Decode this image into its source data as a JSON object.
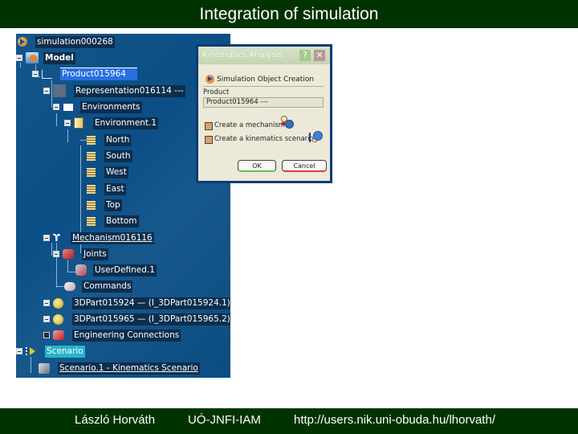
{
  "slide": {
    "title": "Integration of simulation"
  },
  "footer": {
    "author": "László Horváth",
    "institution": "UÓ-JNFI-IAM",
    "url": "http://users.nik.uni-obuda.hu/lhorvath/"
  },
  "tree": {
    "items": [
      {
        "label": "simulation000268",
        "icon": "simulation-icon",
        "depth": 0
      },
      {
        "label": "Model",
        "icon": "model-icon",
        "depth": 0
      },
      {
        "label": "Product015964",
        "icon": "product-icon",
        "depth": 1,
        "state": "selected"
      },
      {
        "label": "Representation016114 ---",
        "icon": "representation-icon",
        "depth": 2
      },
      {
        "label": "Environments",
        "icon": "environments-icon",
        "depth": 3
      },
      {
        "label": "Environment.1",
        "icon": "environment-icon",
        "depth": 4
      },
      {
        "label": "North",
        "icon": "wall-icon",
        "depth": 5
      },
      {
        "label": "South",
        "icon": "wall-icon",
        "depth": 5
      },
      {
        "label": "West",
        "icon": "wall-icon",
        "depth": 5
      },
      {
        "label": "East",
        "icon": "wall-icon",
        "depth": 5
      },
      {
        "label": "Top",
        "icon": "wall-icon",
        "depth": 5
      },
      {
        "label": "Bottom",
        "icon": "wall-icon",
        "depth": 5
      },
      {
        "label": "Mechanism016116",
        "icon": "mechanism-icon",
        "depth": 2
      },
      {
        "label": "Joints",
        "icon": "joints-icon",
        "depth": 3
      },
      {
        "label": "UserDefined.1",
        "icon": "joint-icon",
        "depth": 4
      },
      {
        "label": "Commands",
        "icon": "commands-icon",
        "depth": 3
      },
      {
        "label": "3DPart015924 — (I_3DPart015924.1)",
        "icon": "part-icon",
        "depth": 2
      },
      {
        "label": "3DPart015965 — (I_3DPart015965.2)",
        "icon": "part-icon",
        "depth": 2
      },
      {
        "label": "Engineering Connections",
        "icon": "connections-icon",
        "depth": 2
      },
      {
        "label": "Scenario",
        "icon": "scenario-icon",
        "depth": 0,
        "state": "highlighted"
      },
      {
        "label": "Scenario.1 - Kinematics Scenario",
        "icon": "kinematics-scenario-icon",
        "depth": 1
      }
    ]
  },
  "dialog": {
    "title": "Kinematics Analysis",
    "help_label": "?",
    "close_label": "✕",
    "section_label": "Simulation Object Creation",
    "product_label": "Product",
    "product_value": "Product015964 ---",
    "options": [
      {
        "label": "Create a mechanism",
        "checked": false
      },
      {
        "label": "Create a kinematics scenario",
        "checked": false
      }
    ],
    "ok_label": "OK",
    "cancel_label": "Cancel"
  }
}
